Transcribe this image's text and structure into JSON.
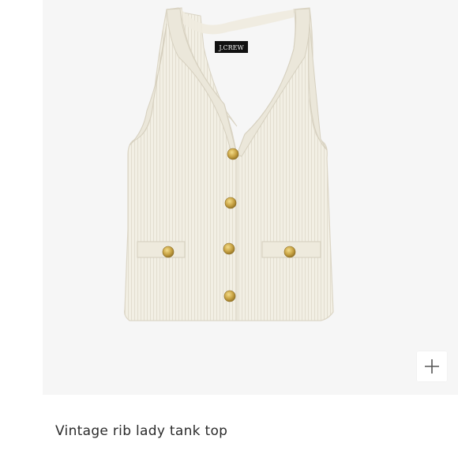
{
  "product": {
    "image_alt": "Vintage rib lady tank top",
    "brand_label": "J.CREW",
    "name": "Vintage rib lady tank top"
  },
  "controls": {
    "zoom_icon": "plus-icon"
  },
  "colors": {
    "panel_background": "#f6f6f6",
    "garment_fabric": "#f2efe4",
    "button_gold": "#c9a445",
    "label_background": "#111111",
    "caption_text": "#2b2b2b"
  }
}
